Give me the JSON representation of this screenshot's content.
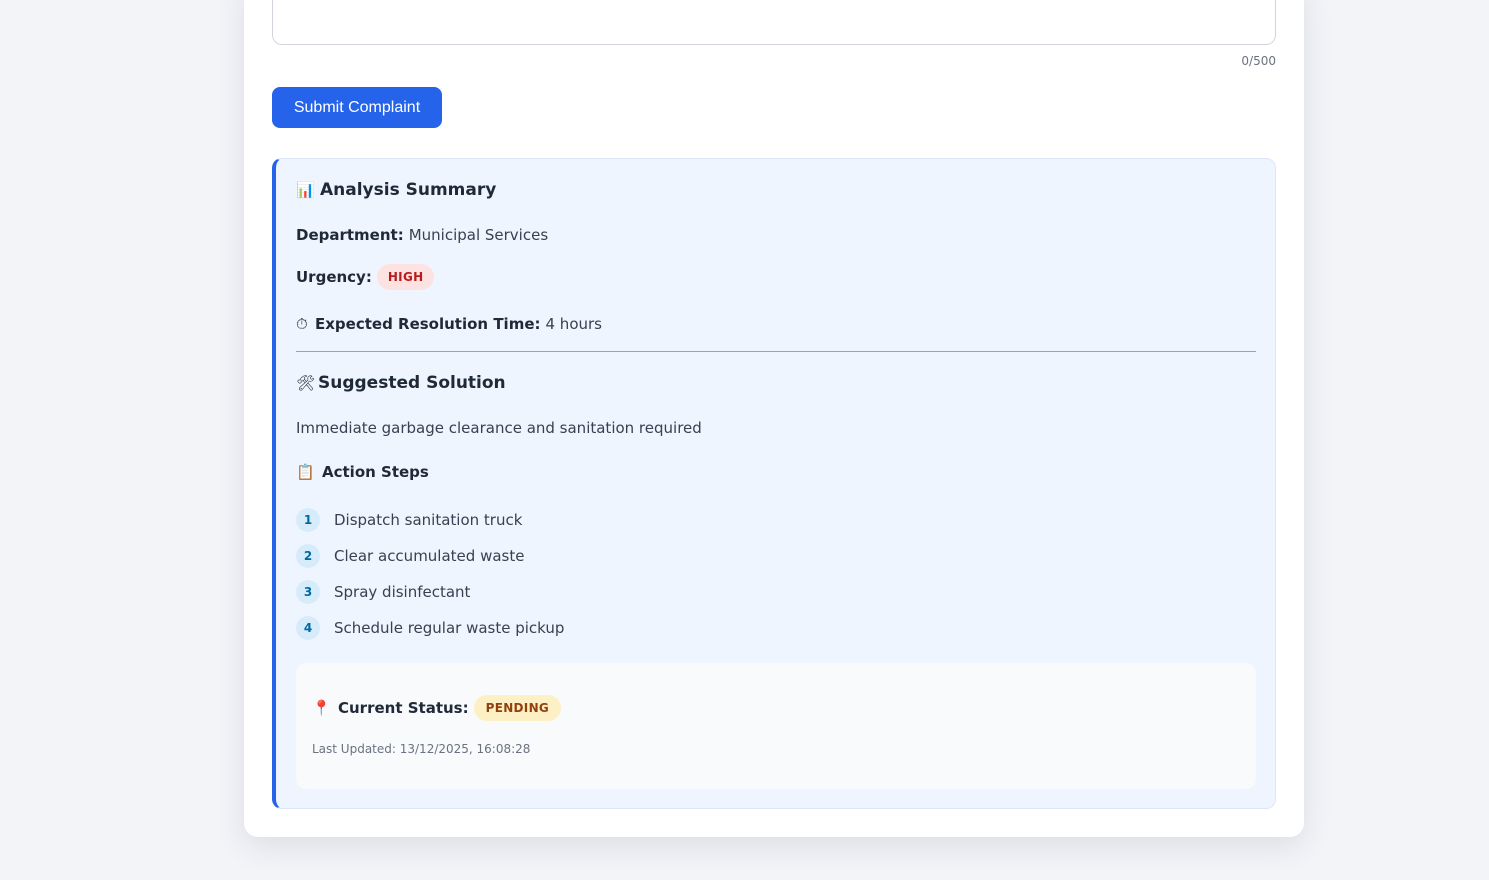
{
  "form": {
    "char_count": "0/500",
    "submit_label": "Submit Complaint"
  },
  "analysis": {
    "title_icon": "📊",
    "title": "Analysis Summary",
    "department_label": "Department:",
    "department_value": "Municipal Services",
    "urgency_label": "Urgency:",
    "urgency_value": "HIGH",
    "time_icon": "⏱",
    "time_label": "Expected Resolution Time:",
    "time_value": "4 hours",
    "solution_icon": "🛠",
    "solution_title": "Suggested Solution",
    "solution_text": "Immediate garbage clearance and sanitation required",
    "steps_icon": "📋",
    "steps_title": "Action Steps",
    "steps": [
      {
        "num": "1",
        "text": "Dispatch sanitation truck"
      },
      {
        "num": "2",
        "text": "Clear accumulated waste"
      },
      {
        "num": "3",
        "text": "Spray disinfectant"
      },
      {
        "num": "4",
        "text": "Schedule regular waste pickup"
      }
    ],
    "status_icon": "📍",
    "status_label": "Current Status:",
    "status_value": "PENDING",
    "last_updated": "Last Updated: 13/12/2025, 16:08:28"
  },
  "colors": {
    "accent": "#2563eb",
    "urgency_bg": "#fde2e2",
    "urgency_text": "#b91c1c",
    "status_bg": "#fdf0c4",
    "status_text": "#92400e"
  }
}
